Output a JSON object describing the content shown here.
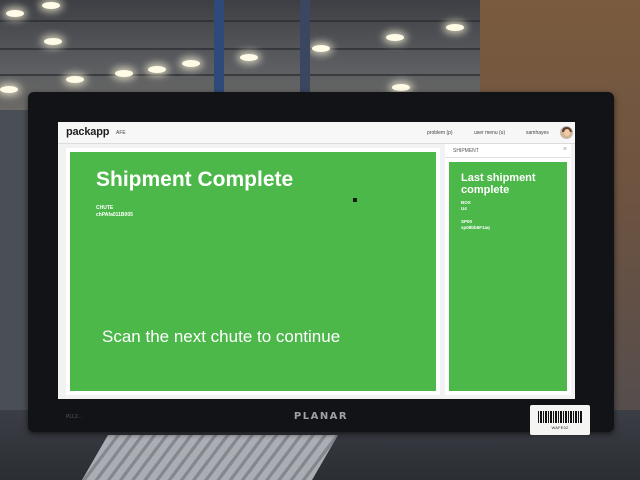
{
  "app": {
    "logo": "packapp",
    "site": "AFE"
  },
  "header": {
    "problem_link": "problem (p)",
    "user_menu_link": "user menu (u)",
    "username": "samhayes"
  },
  "main": {
    "title": "Shipment Complete",
    "chute_label": "CHUTE",
    "chute_value": "chPAfa011B005",
    "instruction": "Scan the next chute to continue"
  },
  "side": {
    "panel_title": "SHIPMENT",
    "close_glyph": "×",
    "card_title": "Last shipment complete",
    "box_label": "BOX",
    "box_value": "U4",
    "sp_label": "SP00",
    "sp_value": "sp08bb6F1aq"
  },
  "monitor": {
    "brand": "PLANAR",
    "model": "PLL2..."
  },
  "scene": {
    "sticker_text": "WAFE02"
  },
  "colors": {
    "success_green": "#4db84a",
    "screen_bg": "#f2f2f2"
  }
}
